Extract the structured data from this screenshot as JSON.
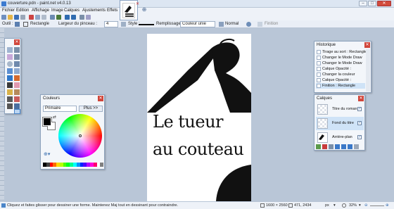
{
  "window": {
    "title": "couverture.pdn - paint.net v4.0.13"
  },
  "menu": [
    "Fichier",
    "Edition",
    "Affichage",
    "Image",
    "Calques",
    "Ajustements",
    "Effets"
  ],
  "toolbar2": {
    "tool_label": "Outil :",
    "shape_value": "Rectangle",
    "brush_width_label": "Largeur du pinceau :",
    "brush_width_value": "4",
    "style_label": "Style :",
    "fill_label": "Remplissage :",
    "fill_value": "Couleur unie",
    "blend_value": "Normal",
    "finish_label": "Finition"
  },
  "canvas": {
    "line1": "Le tueur",
    "line2": "au couteau"
  },
  "colors_panel": {
    "title": "Couleurs",
    "selector_value": "Primaire",
    "more_button": "Plus >>",
    "palette": [
      "#000000",
      "#404040",
      "#ff0000",
      "#ff6a00",
      "#ffd800",
      "#b6ff00",
      "#4cff00",
      "#00ff21",
      "#00ff90",
      "#00ffff",
      "#0094ff",
      "#0026ff",
      "#4800ff",
      "#b200ff",
      "#ff00dc",
      "#ff006e",
      "#ffffff",
      "#808080"
    ]
  },
  "history_panel": {
    "title": "Historique",
    "items": [
      "Tirage au sort : Rectangle",
      "Changer le Mode Draw",
      "Changer le Mode Draw",
      "Calque Opacité :",
      "Changer la couleur",
      "Calque Opacité :",
      "Finition : Rectangle"
    ]
  },
  "layers_panel": {
    "title": "Calques",
    "layers": [
      {
        "name": "Titre du roman",
        "visible": "✓"
      },
      {
        "name": "Fond du titre",
        "visible": "✓"
      },
      {
        "name": "Arrière-plan",
        "visible": "✓"
      }
    ]
  },
  "status": {
    "hint": "Cliquez et faites glisser pour dessiner une forme. Maintenez Maj tout en dessinant pour contraindre.",
    "size": "1600 × 2560",
    "cursor": "471, 2434",
    "unit": "px",
    "zoom": "32%"
  }
}
